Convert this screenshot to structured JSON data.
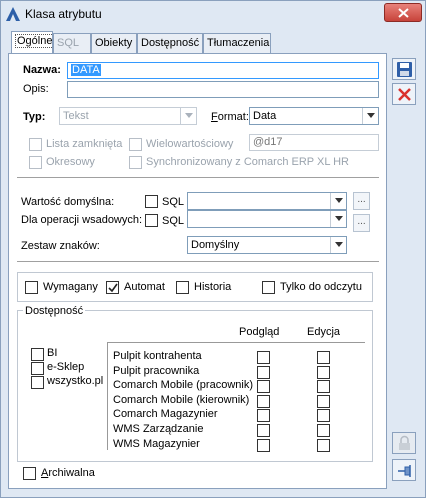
{
  "window": {
    "title": "Klasa atrybutu"
  },
  "tabs": [
    {
      "label": "Ogólne",
      "state": "active"
    },
    {
      "label": "SQL",
      "state": "disabled"
    },
    {
      "label": "Obiekty",
      "state": "normal"
    },
    {
      "label": "Dostępność",
      "state": "normal"
    },
    {
      "label": "Tłumaczenia",
      "state": "normal"
    }
  ],
  "form": {
    "nazwa_label": "Nazwa:",
    "nazwa_value": "DATA",
    "opis_label": "Opis:",
    "opis_value": "",
    "typ_label": "Typ:",
    "typ_value": "Tekst",
    "format_label": "Format:",
    "format_value": "Data",
    "lista_zamknieta": "Lista zamknięta",
    "wielowartosciowy": "Wielowartościowy",
    "wielowartosciowy_value": "@d17",
    "okresowy": "Okresowy",
    "synchronizowany": "Synchronizowany z Comarch ERP XL HR",
    "wartosc_domyslna_label": "Wartość domyślna:",
    "sql_label": "SQL",
    "dla_operacji_label": "Dla operacji wsadowych:",
    "zestaw_znakow_label": "Zestaw znaków:",
    "zestaw_znakow_value": "Domyślny",
    "dots": "..."
  },
  "flags": {
    "wymagany": {
      "label": "Wymagany",
      "checked": false
    },
    "automat": {
      "label": "Automat",
      "checked": true
    },
    "historia": {
      "label": "Historia",
      "checked": false
    },
    "tylko_do_odczytu": {
      "label": "Tylko do odczytu",
      "checked": false
    }
  },
  "dostepnosc": {
    "title": "Dostępność",
    "channels": [
      "BI",
      "e-Sklep",
      "wszystko.pl"
    ],
    "col_podglad": "Podgląd",
    "col_edycja": "Edycja",
    "rows": [
      "Pulpit kontrahenta",
      "Pulpit pracownika",
      "Comarch Mobile (pracownik)",
      "Comarch Mobile (kierownik)",
      "Comarch Magazynier",
      "WMS Zarządzanie",
      "WMS Magazynier"
    ]
  },
  "archiwalna": {
    "label": "Archiwalna",
    "checked": false
  },
  "colors": {
    "accent": "#3399ff",
    "delete_red": "#d9302c",
    "save_blue": "#2f5fa8"
  },
  "icons": [
    "app-icon",
    "close-icon",
    "save-icon",
    "delete-icon",
    "lock-icon",
    "pin-icon"
  ]
}
